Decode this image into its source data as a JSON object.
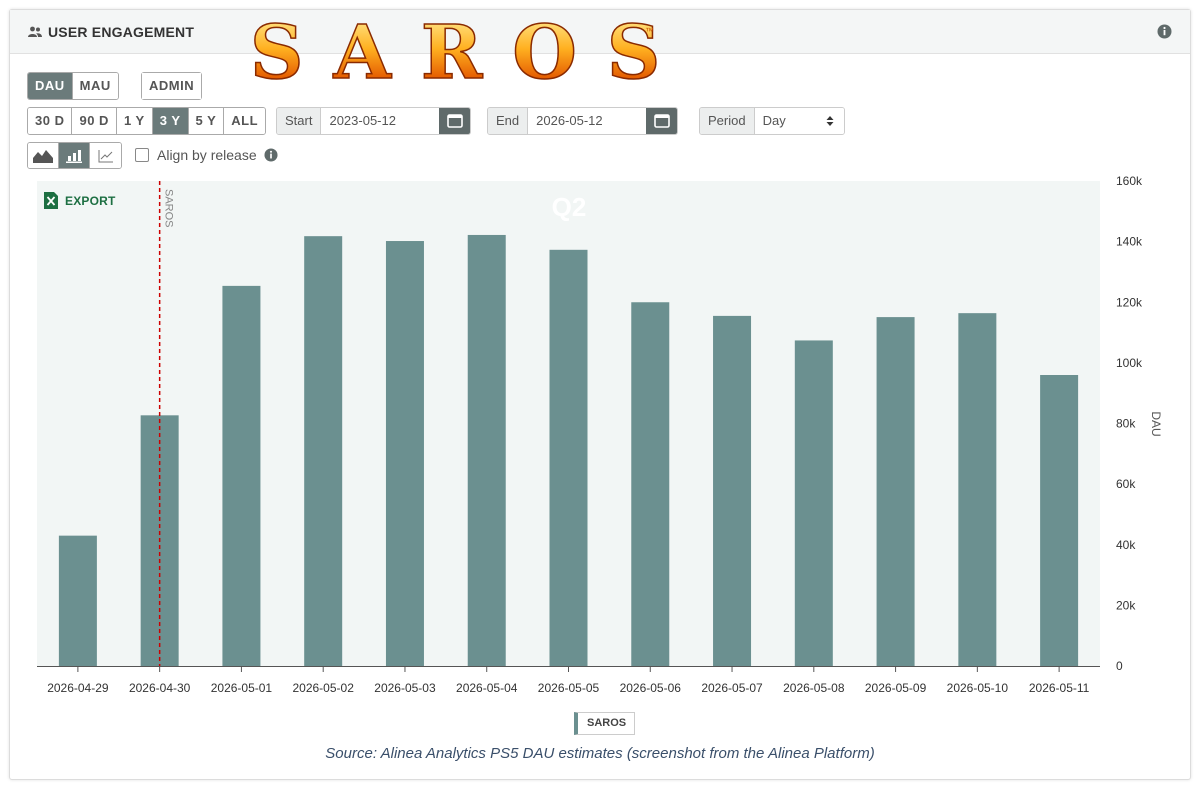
{
  "header": {
    "title": "USER ENGAGEMENT",
    "logo_text": "SAROS",
    "logo_tm": "™"
  },
  "toolbar": {
    "metric_buttons": [
      "DAU",
      "MAU"
    ],
    "metric_active": "DAU",
    "admin_label": "ADMIN",
    "range_buttons": [
      "30 D",
      "90 D",
      "1 Y",
      "3 Y",
      "5 Y",
      "ALL"
    ],
    "range_active": "3 Y",
    "start_label": "Start",
    "start_value": "2023-05-12",
    "end_label": "End",
    "end_value": "2026-05-12",
    "period_label": "Period",
    "period_value": "Day",
    "align_label": "Align by release",
    "export_label": "EXPORT"
  },
  "colors": {
    "bar": "#6b9090",
    "plot_bg": "#f2f6f5",
    "release_line": "#cc0000",
    "active_button": "#6b7b7b"
  },
  "chart_data": {
    "type": "bar",
    "categories": [
      "2026-04-29",
      "2026-04-30",
      "2026-05-01",
      "2026-05-02",
      "2026-05-03",
      "2026-05-04",
      "2026-05-05",
      "2026-05-06",
      "2026-05-07",
      "2026-05-08",
      "2026-05-09",
      "2026-05-10",
      "2026-05-11"
    ],
    "series": [
      {
        "name": "SAROS",
        "values": [
          43000,
          82700,
          125400,
          141800,
          140200,
          142200,
          137300,
          120000,
          115500,
          107400,
          115100,
          116400,
          96000
        ]
      }
    ],
    "ylabel": "DAU",
    "ylim": [
      0,
      160000
    ],
    "yticks": [
      0,
      20000,
      40000,
      60000,
      80000,
      100000,
      120000,
      140000,
      160000
    ],
    "ytick_labels": [
      "0",
      "20k",
      "40k",
      "60k",
      "80k",
      "100k",
      "120k",
      "140k",
      "160k"
    ],
    "annotations": [
      {
        "type": "vertical_line",
        "category": "2026-04-30",
        "label": "SAROS",
        "style": "dashed"
      },
      {
        "type": "text",
        "label": "Q2"
      }
    ],
    "legend": "bottom-center",
    "grid": false
  },
  "footer": {
    "source": "Source: Alinea Analytics PS5 DAU estimates (screenshot from the Alinea Platform)"
  }
}
